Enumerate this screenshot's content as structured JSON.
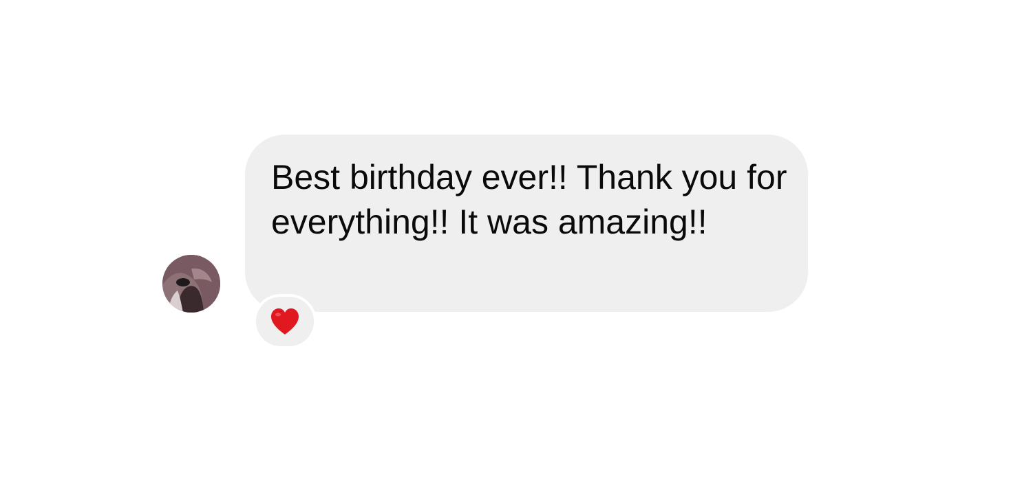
{
  "message": {
    "text": "Best birthday ever!! Thank you for everything!! It was amazing!!",
    "bubble_color": "#efefef",
    "text_color": "#0a0a0a"
  },
  "reaction": {
    "icon": "heart-icon",
    "color": "#e0181f"
  },
  "sender": {
    "avatar_icon": "avatar"
  }
}
